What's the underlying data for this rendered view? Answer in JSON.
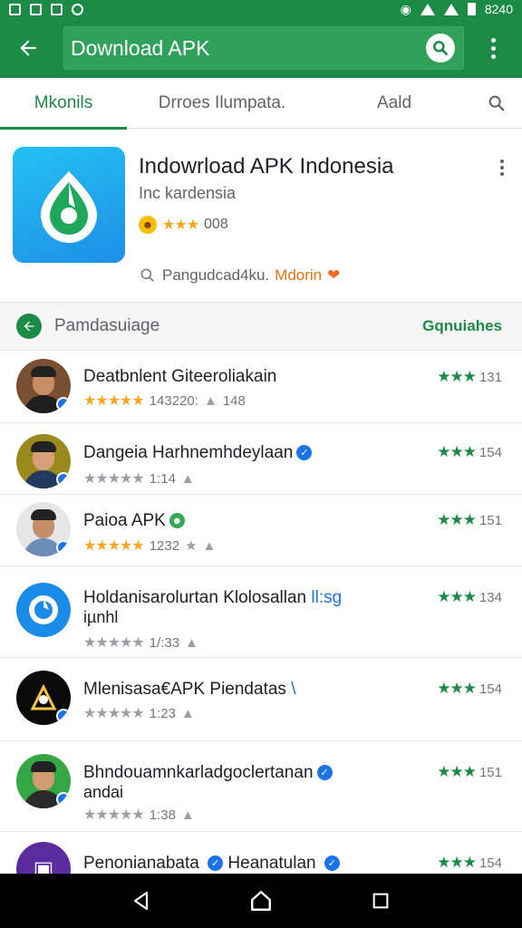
{
  "status_bar": {
    "time": "8240"
  },
  "app_bar": {
    "search_text": "Download APK"
  },
  "tabs": [
    {
      "label": "Mkonils"
    },
    {
      "label": "Drroes Ilumpata."
    },
    {
      "label": "Aald"
    }
  ],
  "app": {
    "title": "Indowrload APK Indonesia",
    "subtitle": "Inc kardensia",
    "rating_count": "008",
    "meta_text": "Pangudcad4ku.",
    "developer": "Mdorin"
  },
  "section": {
    "title": "Pamdasuiage",
    "action": "Gqnuiahes"
  },
  "list": [
    {
      "name": "Deatbnlent Giteeroliakain",
      "name2": "",
      "stars_filled": 4,
      "count": "143220:",
      "extra": "148",
      "right_count": "131"
    },
    {
      "name": "Dangeia Harhnemhdeylaan",
      "name2": "",
      "stars_filled": 0,
      "count": "1:14",
      "extra": "",
      "right_count": "154"
    },
    {
      "name": "Paioa APK",
      "name2": "",
      "stars_filled": 4,
      "count": "1232",
      "extra": "",
      "right_count": "151"
    },
    {
      "name": "Holdanisarolurtan Klolosallan",
      "name_tag": "ll:sg",
      "name2": "iµnhl",
      "stars_filled": 0,
      "count": "1/:33",
      "extra": "",
      "right_count": "134"
    },
    {
      "name": "Mlenisasa€APK Piendatas",
      "name_tag": "\\",
      "name2": "",
      "stars_filled": 0,
      "count": "1:23",
      "extra": "",
      "right_count": "154"
    },
    {
      "name": "Bhndouamnkarladgoclertanan",
      "name2": "andai",
      "stars_filled": 0,
      "count": "1:38",
      "extra": "",
      "right_count": "151"
    },
    {
      "name": "Penonianabata",
      "name_tag": "Heanatulan",
      "name2": "",
      "stars_filled": 0,
      "count": "",
      "extra": "",
      "right_count": "154"
    }
  ],
  "colors": {
    "primary": "#1b8b46",
    "star_orange": "#f5a623",
    "accent_blue": "#1a73e8"
  }
}
